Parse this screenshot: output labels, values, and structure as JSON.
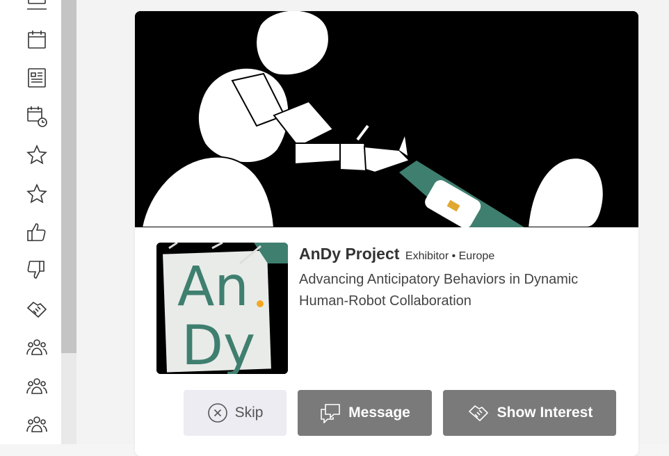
{
  "sidebar": {
    "items": [
      {
        "icon": "presentation-icon"
      },
      {
        "icon": "calendar-icon"
      },
      {
        "icon": "document-list-icon"
      },
      {
        "icon": "calendar-clock-icon"
      },
      {
        "icon": "star-icon"
      },
      {
        "icon": "star-icon"
      },
      {
        "icon": "thumbs-up-icon"
      },
      {
        "icon": "thumbs-down-icon"
      },
      {
        "icon": "handshake-icon"
      },
      {
        "icon": "group-icon"
      },
      {
        "icon": "group-icon"
      },
      {
        "icon": "group-icon"
      }
    ]
  },
  "card": {
    "name": "AnDy Project",
    "meta": "Exhibitor • Europe",
    "description": "Advancing Anticipatory Behaviors in Dynamic Human-Robot Collaboration",
    "logo_text_top": "An",
    "logo_text_bottom": "Dy"
  },
  "actions": {
    "skip_label": "Skip",
    "message_label": "Message",
    "interest_label": "Show Interest"
  },
  "colors": {
    "accent_green": "#3f7f6f",
    "button_gray": "#7a7a7a",
    "skip_bg": "#ececf2",
    "logo_dot": "#f5a623"
  }
}
